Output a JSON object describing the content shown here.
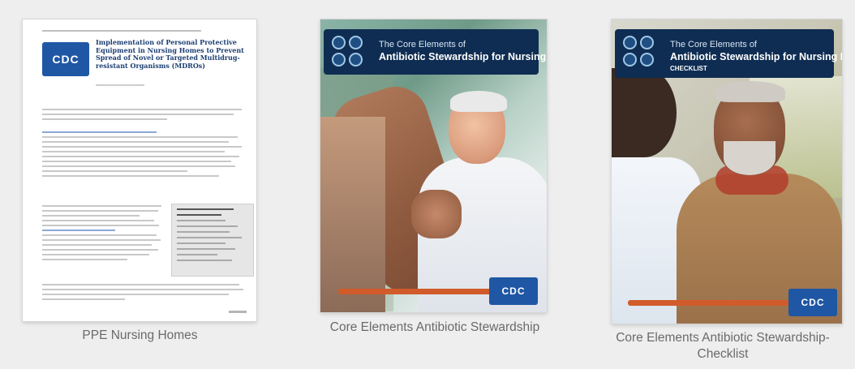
{
  "cards": [
    {
      "caption": "PPE Nursing Homes",
      "doc": {
        "title": "Implementation of Personal Protective Equipment in Nursing Homes to Prevent Spread of Novel or Targeted Multidrug-resistant Organisms (MDROs)",
        "logo_text": "CDC"
      }
    },
    {
      "caption": "Core Elements Antibiotic Stewardship",
      "cover": {
        "line1": "The Core Elements of",
        "line2": "Antibiotic Stewardship for Nursing Homes",
        "logo_text": "CDC"
      }
    },
    {
      "caption_line1": "Core Elements Antibiotic Stewardship-",
      "caption_line2": "Checklist",
      "cover": {
        "line1": "The Core Elements of",
        "line2": "Antibiotic Stewardship for Nursing Homes",
        "line3": "CHECKLIST",
        "logo_text": "CDC"
      }
    }
  ],
  "colors": {
    "cdc_blue": "#1f57a4",
    "banner_navy": "#0f2d52",
    "accent_orange": "#d15b2a",
    "caption_gray": "#6a6a6a"
  }
}
